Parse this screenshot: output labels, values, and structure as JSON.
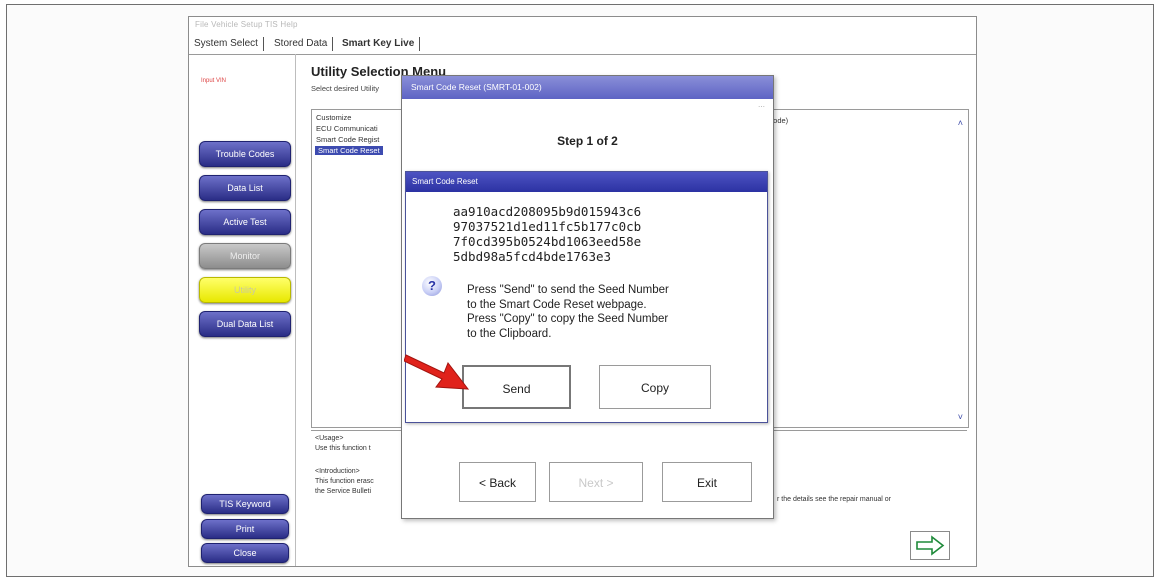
{
  "menubar": {
    "text": "File   Vehicle   Setup   TIS   Help"
  },
  "tabs": [
    {
      "label": "System Select"
    },
    {
      "label": "Stored Data"
    },
    {
      "label": "Smart Key Live"
    }
  ],
  "sidebar": {
    "vin_text": "Input VIN",
    "buttons": {
      "trouble_codes": "Trouble Codes",
      "data_list": "Data List",
      "active_test": "Active Test",
      "monitor": "Monitor",
      "utility": "Utility",
      "dual_data_list": "Dual Data List",
      "tis_keyword": "TIS Keyword",
      "print": "Print",
      "close": "Close"
    }
  },
  "main": {
    "title": "Utility Selection Menu",
    "subtitle": "Select desired Utility",
    "list_items": [
      "Customize",
      "ECU Communicati",
      "Smart Code Regist",
      "Smart Code Reset"
    ],
    "list_right_text": "ig Mode)",
    "desc_lines": [
      "<Usage>",
      "Use this function t",
      "<Introduction>",
      "This function erasc",
      "the Service Bulleti"
    ],
    "desc_right_text": "r the details see the repair manual or"
  },
  "outer_dialog": {
    "title": "Smart Code Reset (SMRT-01-002)",
    "step_label": "Step ",
    "step_current": "1",
    "step_of": " of ",
    "step_total": "2",
    "back_label": "< Back",
    "next_label": "Next >",
    "exit_label": "Exit"
  },
  "inner_dialog": {
    "title": "Smart Code Reset",
    "seed_lines": [
      "aa910acd208095b9d015943c6",
      "97037521d1ed11fc5b177c0cb",
      "7f0cd395b0524bd1063eed58e",
      "5dbd98a5fcd4bde1763e3"
    ],
    "message_lines": [
      "Press \"Send\" to send the Seed Number",
      "to the Smart Code Reset webpage.",
      "Press \"Copy\" to copy the Seed Number",
      "to the Clipboard."
    ],
    "send_label": "Send",
    "copy_label": "Copy"
  },
  "colors": {
    "sidebar_button": "#3a3e9e",
    "utility_button": "#f2f200",
    "selected_item": "#3d4bb0",
    "highlight_arrow": "#e0221b"
  },
  "icons": {
    "question": "question-icon",
    "next": "next-arrow-icon",
    "pointer": "red-pointer-arrow"
  }
}
